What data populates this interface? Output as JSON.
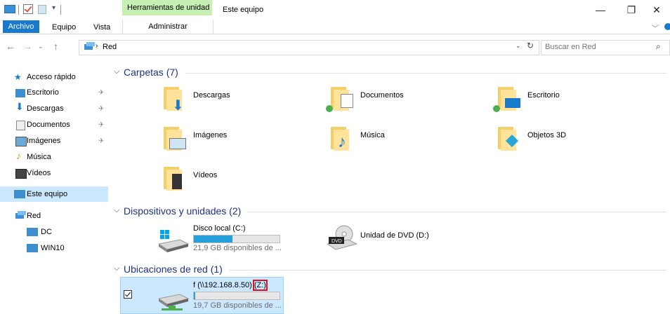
{
  "titlebar": {
    "context_tab": "Herramientas de unidad",
    "window_title": "Este equipo",
    "minimize": "—",
    "restore": "❐",
    "close": "✕"
  },
  "ribbon": {
    "tabs": [
      "Archivo",
      "Equipo",
      "Vista"
    ],
    "context_tab": "Administrar",
    "accent": "#1979ca"
  },
  "address": {
    "location": "Red",
    "search_placeholder": "Buscar en Red"
  },
  "sidebar": {
    "quick_access": "Acceso rápido",
    "items": [
      {
        "label": "Escritorio",
        "pinned": true
      },
      {
        "label": "Descargas",
        "pinned": true
      },
      {
        "label": "Documentos",
        "pinned": true
      },
      {
        "label": "Imágenes",
        "pinned": true
      },
      {
        "label": "Música",
        "pinned": false
      },
      {
        "label": "Vídeos",
        "pinned": false
      }
    ],
    "this_pc": "Este equipo",
    "network": "Red",
    "network_items": [
      "DC",
      "WIN10"
    ]
  },
  "groups": {
    "folders": {
      "title": "Carpetas (7)",
      "items": [
        "Descargas",
        "Documentos",
        "Escritorio",
        "Imágenes",
        "Música",
        "Objetos 3D",
        "Vídeos"
      ]
    },
    "devices": {
      "title": "Dispositivos y unidades (2)",
      "local_disk": {
        "name": "Disco local (C:)",
        "free": "21,9 GB disponibles de ...",
        "used_fraction": 0.45
      },
      "dvd": {
        "name": "Unidad de DVD (D:)"
      }
    },
    "network": {
      "title": "Ubicaciones de red (1)",
      "drive": {
        "name_prefix": "f (\\\\192.168.8.50)",
        "letter": "(Z:)",
        "free": "19,7 GB disponibles de ...",
        "used_fraction": 0.02
      }
    }
  }
}
